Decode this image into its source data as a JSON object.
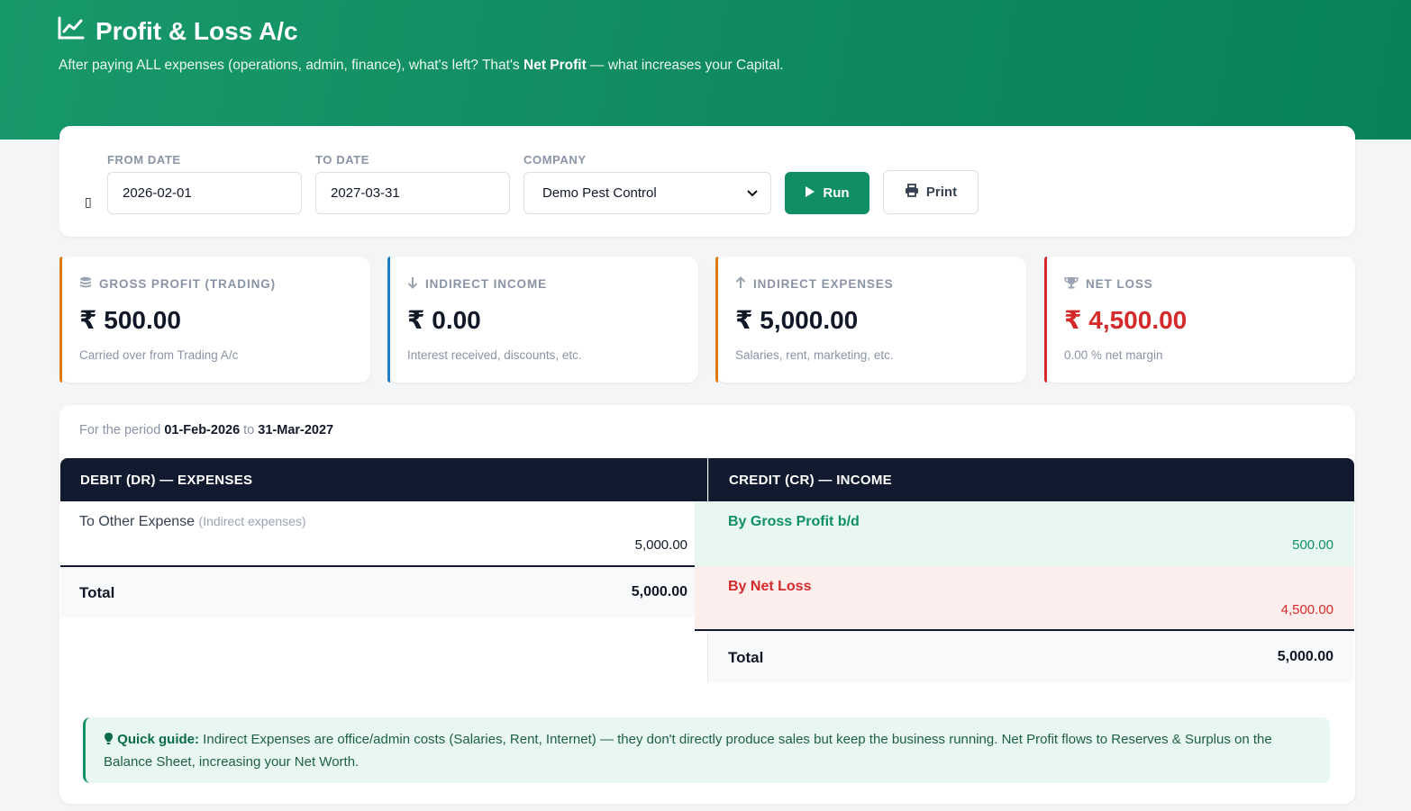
{
  "header": {
    "title": "Profit & Loss A/c",
    "subtitle_pre": "After paying ALL expenses (operations, admin, finance), what's left? That's ",
    "subtitle_bold": "Net Profit",
    "subtitle_post": " — what increases your Capital."
  },
  "filters": {
    "glyph": "▯",
    "from_label": "FROM DATE",
    "from_value": "2026-02-01",
    "to_label": "TO DATE",
    "to_value": "2027-03-31",
    "company_label": "COMPANY",
    "company_value": "Demo Pest Control",
    "run_label": "Run",
    "print_label": "Print"
  },
  "stats": [
    {
      "label": "GROSS PROFIT (TRADING)",
      "value": "₹ 500.00",
      "hint": "Carried over from Trading A/c",
      "accent": "#e07b12",
      "icon": "coins-icon"
    },
    {
      "label": "INDIRECT INCOME",
      "value": "₹ 0.00",
      "hint": "Interest received, discounts, etc.",
      "accent": "#1e7fc7",
      "icon": "arrow-down-icon"
    },
    {
      "label": "INDIRECT EXPENSES",
      "value": "₹ 5,000.00",
      "hint": "Salaries, rent, marketing, etc.",
      "accent": "#e07b12",
      "icon": "arrow-up-icon"
    },
    {
      "label": "NET LOSS",
      "value": "₹ 4,500.00",
      "hint": "0.00 % net margin",
      "accent": "#d42a2a",
      "icon": "trophy-icon"
    }
  ],
  "ledger": {
    "period_pre": "For the period ",
    "period_from": "01-Feb-2026",
    "period_mid": " to ",
    "period_to": "31-Mar-2027",
    "debit_header": "DEBIT (DR) — EXPENSES",
    "credit_header": "CREDIT (CR) — INCOME",
    "debit_rows": [
      {
        "name": "To Other Expense",
        "note": "(Indirect expenses)",
        "amount": "5,000.00"
      }
    ],
    "debit_total_label": "Total",
    "debit_total": "5,000.00",
    "credit_rows": [
      {
        "name": "By Gross Profit b/d",
        "amount": "500.00"
      },
      {
        "name": "By Net Loss",
        "amount": "4,500.00"
      }
    ],
    "credit_total_label": "Total",
    "credit_total": "5,000.00"
  },
  "guide": {
    "label": "Quick guide:",
    "text": " Indirect Expenses are office/admin costs (Salaries, Rent, Internet) — they don't directly produce sales but keep the business running. Net Profit flows to Reserves & Surplus on the Balance Sheet, increasing your Net Worth."
  },
  "colors": {
    "brand_green": "#0f8f63",
    "loss_red": "#d42a2a",
    "header_dark": "#111a2e"
  }
}
